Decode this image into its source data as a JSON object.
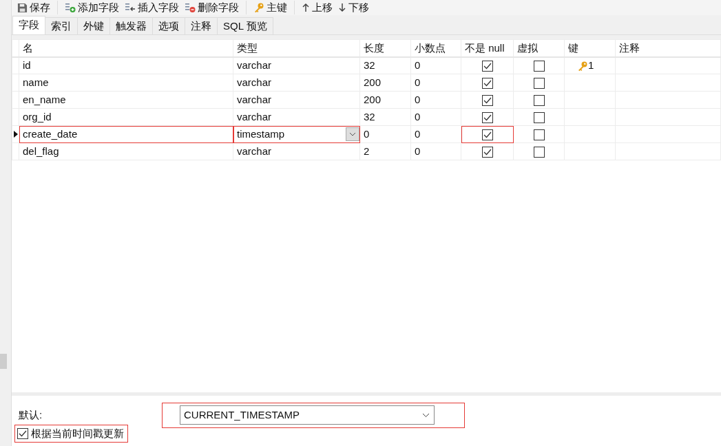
{
  "toolbar": [
    {
      "label": "保存",
      "kind": "save",
      "group_end": true
    },
    {
      "label": "添加字段",
      "kind": "add"
    },
    {
      "label": "插入字段",
      "kind": "insert"
    },
    {
      "label": "删除字段",
      "kind": "delete",
      "group_end": true
    },
    {
      "label": "主键",
      "kind": "key",
      "group_end": true
    },
    {
      "label": "上移",
      "kind": "up"
    },
    {
      "label": "下移",
      "kind": "down"
    }
  ],
  "tabs": [
    {
      "label": "字段",
      "selected": true
    },
    {
      "label": "索引",
      "selected": false
    },
    {
      "label": "外键",
      "selected": false
    },
    {
      "label": "触发器",
      "selected": false
    },
    {
      "label": "选项",
      "selected": false
    },
    {
      "label": "注释",
      "selected": false
    },
    {
      "label": "SQL 预览",
      "selected": false
    }
  ],
  "table": {
    "columns": [
      "名",
      "类型",
      "长度",
      "小数点",
      "不是 null",
      "虚拟",
      "键",
      "注释"
    ],
    "rows": [
      {
        "name": "id",
        "type": "varchar",
        "length": "32",
        "decimals": "0",
        "not_null": true,
        "virtual": false,
        "key": "1",
        "current": false,
        "highlighted": false,
        "not_null_highlighted": false
      },
      {
        "name": "name",
        "type": "varchar",
        "length": "200",
        "decimals": "0",
        "not_null": true,
        "virtual": false,
        "current": false,
        "highlighted": false,
        "not_null_highlighted": false
      },
      {
        "name": "en_name",
        "type": "varchar",
        "length": "200",
        "decimals": "0",
        "not_null": true,
        "virtual": false,
        "current": false,
        "highlighted": false,
        "not_null_highlighted": false
      },
      {
        "name": "org_id",
        "type": "varchar",
        "length": "32",
        "decimals": "0",
        "not_null": true,
        "virtual": false,
        "current": false,
        "highlighted": false,
        "not_null_highlighted": false
      },
      {
        "name": "create_date",
        "type": "timestamp",
        "length": "0",
        "decimals": "0",
        "not_null": true,
        "virtual": false,
        "current": true,
        "highlighted": true,
        "not_null_highlighted": true
      },
      {
        "name": "del_flag",
        "type": "varchar",
        "length": "2",
        "decimals": "0",
        "not_null": true,
        "virtual": false,
        "current": false,
        "highlighted": false,
        "not_null_highlighted": false
      }
    ]
  },
  "properties": {
    "default_label": "默认:",
    "default_value": "CURRENT_TIMESTAMP",
    "default_highlighted": true,
    "on_update": {
      "label": "根据当前时间戳更新",
      "checked": true,
      "highlighted": true
    }
  }
}
